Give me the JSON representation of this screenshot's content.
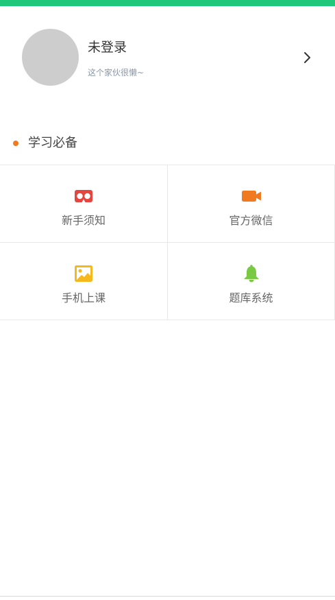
{
  "profile": {
    "name": "未登录",
    "subtitle": "这个家伙很懒~"
  },
  "section": {
    "title": "学习必备"
  },
  "grid": {
    "items": [
      {
        "label": "新手须知",
        "icon": "vr-glasses-icon",
        "color": "#e5443f"
      },
      {
        "label": "官方微信",
        "icon": "video-camera-icon",
        "color": "#f07a20"
      },
      {
        "label": "手机上课",
        "icon": "image-icon",
        "color": "#f5b81d"
      },
      {
        "label": "题库系统",
        "icon": "bell-icon",
        "color": "#7ac943"
      }
    ]
  },
  "colors": {
    "accent": "#1fc77a",
    "section_dot": "#f07a20"
  }
}
